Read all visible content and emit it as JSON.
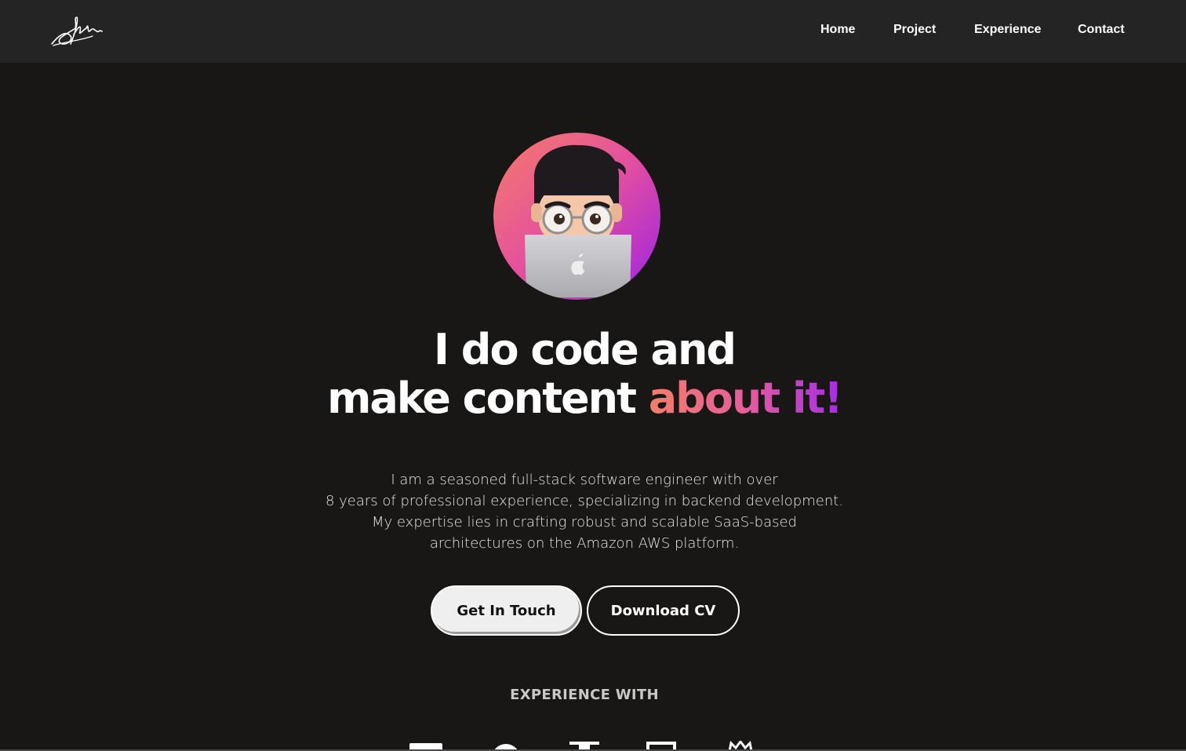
{
  "nav": {
    "logo_icon": "signature-logo",
    "links": [
      "Home",
      "Project",
      "Experience",
      "Contact"
    ]
  },
  "hero": {
    "avatar_icon": "memoji-avatar-with-laptop",
    "headline": {
      "line1": "I do code and",
      "line2_plain": "make content ",
      "line2_accent": "about it!"
    },
    "bio": [
      "I am a seasoned full-stack software engineer with over",
      "8 years of professional experience, specializing in backend development.",
      "My expertise lies in crafting robust and scalable SaaS-based",
      "architectures on the Amazon AWS platform."
    ],
    "buttons": {
      "primary": "Get In Touch",
      "secondary": "Download CV"
    }
  },
  "experience": {
    "title": "EXPERIENCE WITH",
    "icons": [
      "tech-logo-1-icon",
      "tech-logo-2-icon",
      "tech-logo-3-icon",
      "tech-logo-4-icon",
      "tech-logo-5-icon"
    ]
  },
  "colors": {
    "background": "#191716",
    "navbar": "#242424",
    "accent_gradient": [
      "#f17f6a",
      "#e55d9c",
      "#a32ee6"
    ]
  }
}
